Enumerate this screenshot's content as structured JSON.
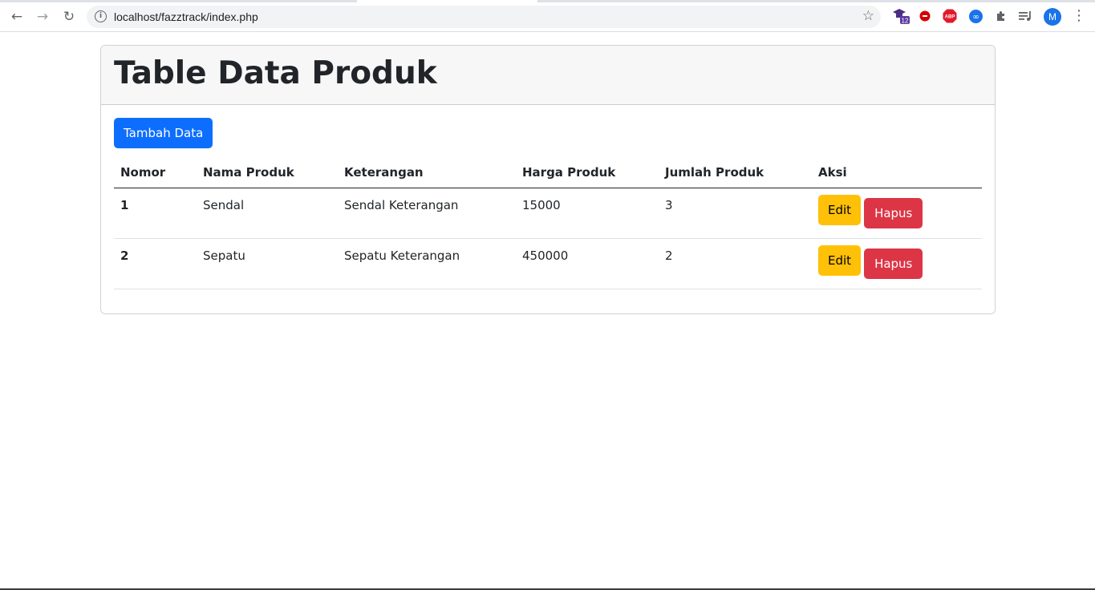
{
  "browser": {
    "url": "localhost/fazztrack/index.php",
    "extension_badge": "12",
    "abp_label": "ABP",
    "avatar_letter": "M",
    "icons": [
      "back-arrow-icon",
      "forward-arrow-icon",
      "reload-icon",
      "info-icon",
      "star-icon",
      "graduation-cap-icon",
      "red-circle-icon",
      "adblock-icon",
      "loop-icon",
      "puzzle-icon",
      "media-queue-icon",
      "kebab-menu-icon"
    ]
  },
  "page": {
    "title": "Table Data Produk",
    "add_button": "Tambah Data",
    "columns": [
      "Nomor",
      "Nama Produk",
      "Keterangan",
      "Harga Produk",
      "Jumlah Produk",
      "Aksi"
    ],
    "rows": [
      {
        "nomor": "1",
        "nama": "Sendal",
        "keterangan": "Sendal Keterangan",
        "harga": "15000",
        "jumlah": "3",
        "edit": "Edit",
        "hapus": "Hapus"
      },
      {
        "nomor": "2",
        "nama": "Sepatu",
        "keterangan": "Sepatu Keterangan",
        "harga": "450000",
        "jumlah": "2",
        "edit": "Edit",
        "hapus": "Hapus"
      }
    ]
  },
  "colors": {
    "primary": "#0d6efd",
    "warning": "#ffc107",
    "danger": "#dc3545",
    "header_bg": "#f7f7f7"
  }
}
